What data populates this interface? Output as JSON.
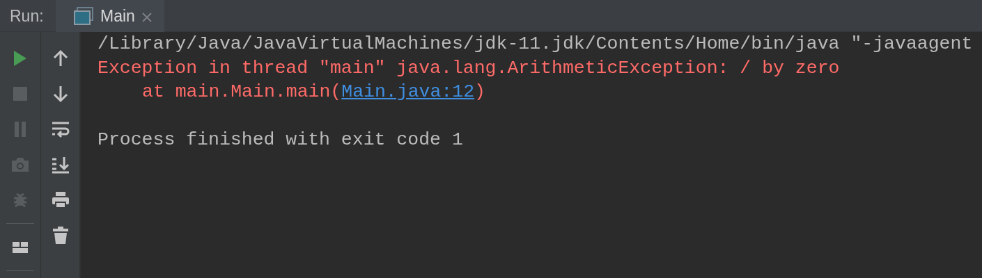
{
  "panel": {
    "label": "Run:"
  },
  "tabs": [
    {
      "label": "Main",
      "selected": true,
      "closable": true
    }
  ],
  "left_toolbar": [
    {
      "kind": "run",
      "disabled": false
    },
    {
      "kind": "stop",
      "disabled": true
    },
    {
      "kind": "pause",
      "disabled": true
    },
    {
      "kind": "camera",
      "disabled": true
    },
    {
      "kind": "bug",
      "disabled": true
    },
    {
      "kind": "separator"
    },
    {
      "kind": "layout",
      "disabled": false
    },
    {
      "kind": "separator"
    }
  ],
  "right_toolbar": [
    {
      "kind": "up"
    },
    {
      "kind": "down"
    },
    {
      "kind": "wrap"
    },
    {
      "kind": "scroll-end"
    },
    {
      "kind": "print"
    },
    {
      "kind": "trash"
    }
  ],
  "console": [
    {
      "kind": "command",
      "text": "/Library/Java/JavaVirtualMachines/jdk-11.jdk/Contents/Home/bin/java \"-javaagent"
    },
    {
      "kind": "error",
      "text": "Exception in thread \"main\" java.lang.ArithmeticException: / by zero"
    },
    {
      "kind": "trace",
      "text": "at main.Main.main(",
      "link": "Main.java:12",
      "after": ")"
    },
    {
      "kind": "exit",
      "text": "Process finished with exit code 1"
    }
  ]
}
